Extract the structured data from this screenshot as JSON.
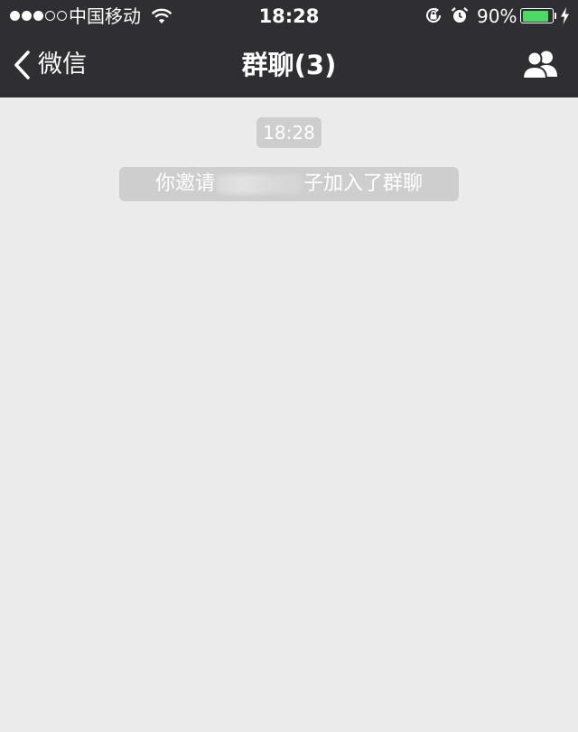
{
  "status_bar": {
    "carrier": "中国移动",
    "time": "18:28",
    "battery_percent": "90%",
    "battery_level": 0.9,
    "signal_bars_filled": 3,
    "signal_bars_total": 5,
    "battery_color": "#4cd964"
  },
  "nav": {
    "back_label": "微信",
    "title": "群聊(3)",
    "contacts_icon": "group-members-icon"
  },
  "chat": {
    "timestamp": "18:28",
    "system_message": {
      "prefix": "你邀请",
      "suffix": "子加入了群聊"
    }
  },
  "colors": {
    "header_bg": "#2e2e33",
    "chat_bg": "#ebebeb",
    "pill_bg": "#cecece"
  }
}
